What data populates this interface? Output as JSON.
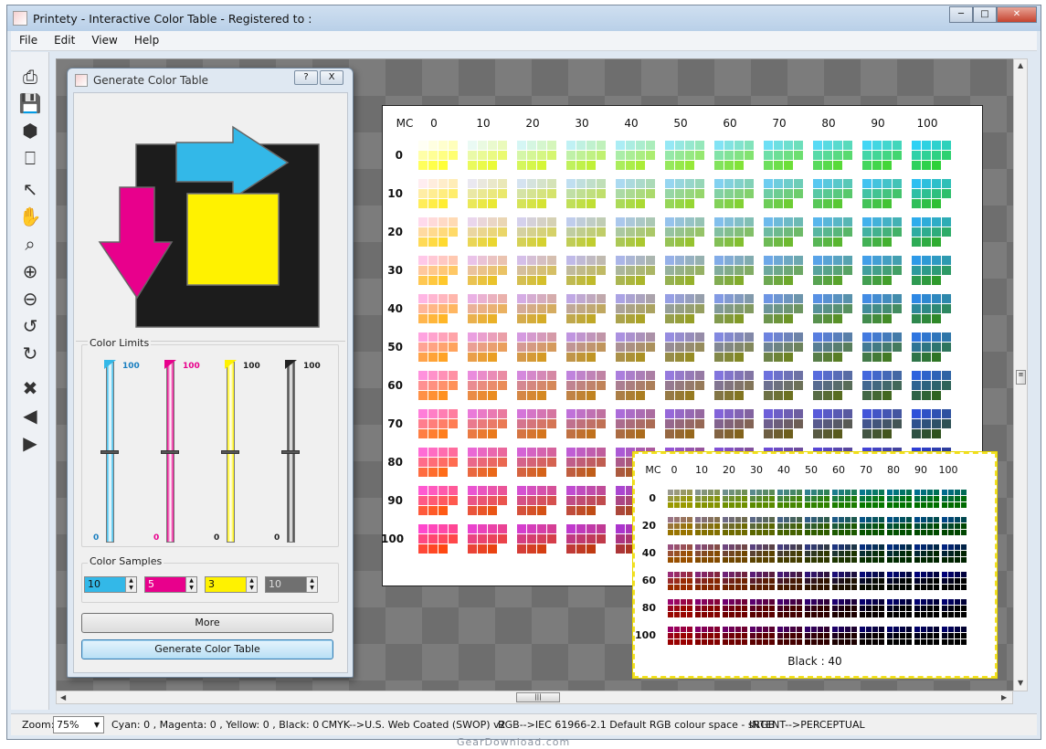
{
  "window": {
    "title": "Printety - Interactive Color Table - Registered to :",
    "controls": [
      "minimize",
      "maximize",
      "close"
    ]
  },
  "menu": [
    "File",
    "Edit",
    "View",
    "Help"
  ],
  "toolbar_icons": [
    "printer-icon",
    "save-icon",
    "palette-icon",
    "print-preview-icon",
    "pointer-icon",
    "hand-icon",
    "zoom-area-icon",
    "zoom-in-icon",
    "zoom-out-icon",
    "rotate-left-icon",
    "rotate-right-icon",
    "delete-icon",
    "previous-icon",
    "next-icon"
  ],
  "table_main": {
    "corner": "MC",
    "columns": [
      "0",
      "10",
      "20",
      "30",
      "40",
      "50",
      "60",
      "70",
      "80",
      "90",
      "100"
    ],
    "rows": [
      "0",
      "10",
      "20",
      "30",
      "40",
      "50",
      "60",
      "70",
      "80",
      "90",
      "100"
    ]
  },
  "table_popup": {
    "corner": "MC",
    "columns": [
      "0",
      "10",
      "20",
      "30",
      "40",
      "50",
      "60",
      "70",
      "80",
      "90",
      "100"
    ],
    "rows": [
      "0",
      "20",
      "40",
      "60",
      "80",
      "100"
    ],
    "caption": "Black : 40"
  },
  "dialog": {
    "title": "Generate Color Table",
    "help_button": "?",
    "close_button": "X",
    "color_limits_label": "Color Limits",
    "color_samples_label": "Color Samples",
    "sliders": [
      {
        "name": "cyan",
        "color": "#33b8e8",
        "max": "100",
        "min": "0",
        "level": 0.5
      },
      {
        "name": "magenta",
        "color": "#e8008c",
        "max": "100",
        "min": "0",
        "level": 0.5
      },
      {
        "name": "yellow",
        "color": "#fff200",
        "max": "100",
        "min": "0",
        "level": 0.5
      },
      {
        "name": "black",
        "color": "#333333",
        "max": "100",
        "min": "0",
        "level": 0.5
      }
    ],
    "samples": [
      {
        "name": "cyan",
        "value": "10",
        "color": "#33b8e8"
      },
      {
        "name": "magenta",
        "value": "5",
        "color": "#e8008c"
      },
      {
        "name": "yellow",
        "value": "3",
        "color": "#fff200"
      },
      {
        "name": "black",
        "value": "10",
        "color": "#707070"
      }
    ],
    "more_button": "More",
    "generate_button": "Generate Color Table"
  },
  "status": {
    "zoom_label": "Zoom:",
    "zoom_value": "75%",
    "channels": "Cyan: 0 , Magenta: 0 , Yellow: 0 , Black: 0",
    "cmyk_profile": "CMYK-->U.S. Web Coated (SWOP) v2",
    "rgb_profile": "RGB-->IEC 61966-2.1 Default RGB colour space - sRGB",
    "intent": "INTENT-->PERCEPTUAL"
  },
  "watermark": "GearDownload.com"
}
